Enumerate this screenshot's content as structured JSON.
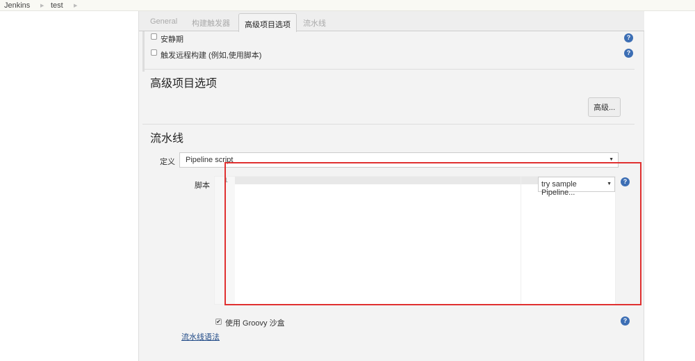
{
  "breadcrumb": [
    "Jenkins",
    "test"
  ],
  "tabs": [
    "General",
    "构建触发器",
    "高级项目选项",
    "流水线"
  ],
  "active_tab": "高级项目选项",
  "triggers": [
    {
      "label": "安静期",
      "checked": false
    },
    {
      "label": "触发远程构建 (例如,使用脚本)",
      "checked": false
    }
  ],
  "advanced": {
    "title": "高级项目选项",
    "button": "高级..."
  },
  "pipeline": {
    "title": "流水线",
    "definition_label": "定义",
    "definition_value": "Pipeline script",
    "script_label": "脚本",
    "line_number": "1",
    "sample_select": "try sample Pipeline...",
    "sandbox_label": "使用 Groovy 沙盒",
    "sandbox_checked": true,
    "syntax_link": "流水线语法"
  },
  "help": "?"
}
